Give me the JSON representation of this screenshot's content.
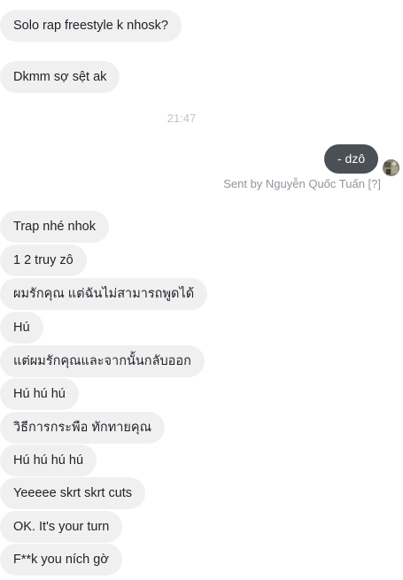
{
  "messages_top": [
    {
      "text": "Solo rap freestyle k nhosk?"
    },
    {
      "text": "Dkmm sợ sệt ak"
    }
  ],
  "timestamp": "21:47",
  "outgoing": {
    "text": "- dzô",
    "color": "#4b4f56"
  },
  "sent_by": "Sent by Nguyễn Quốc Tuấn [?]",
  "avatar_icon": "user-avatar-photo",
  "messages_bottom": [
    {
      "text": "Trap nhé nhok"
    },
    {
      "text": "1 2 truy zô"
    },
    {
      "text": "ผมรักคุณ แต่ฉันไม่สามารถพูดได้"
    },
    {
      "text": "Hú"
    },
    {
      "text": "แต่ผมรักคุณและจากนั้นกลับออก"
    },
    {
      "text": "Hú hú hú"
    },
    {
      "text": "วิธีการกระพือ ทักทายคุณ"
    },
    {
      "text": "Hú hú hú hú"
    },
    {
      "text": "Yeeeee skrt skrt cuts"
    },
    {
      "text": "OK. It's your turn"
    },
    {
      "text": "F**k you ních gờ"
    }
  ],
  "colors": {
    "incoming_bubble": "#f1f0f0",
    "outgoing_bubble": "#4b4f56",
    "meta_text": "#90949c"
  }
}
